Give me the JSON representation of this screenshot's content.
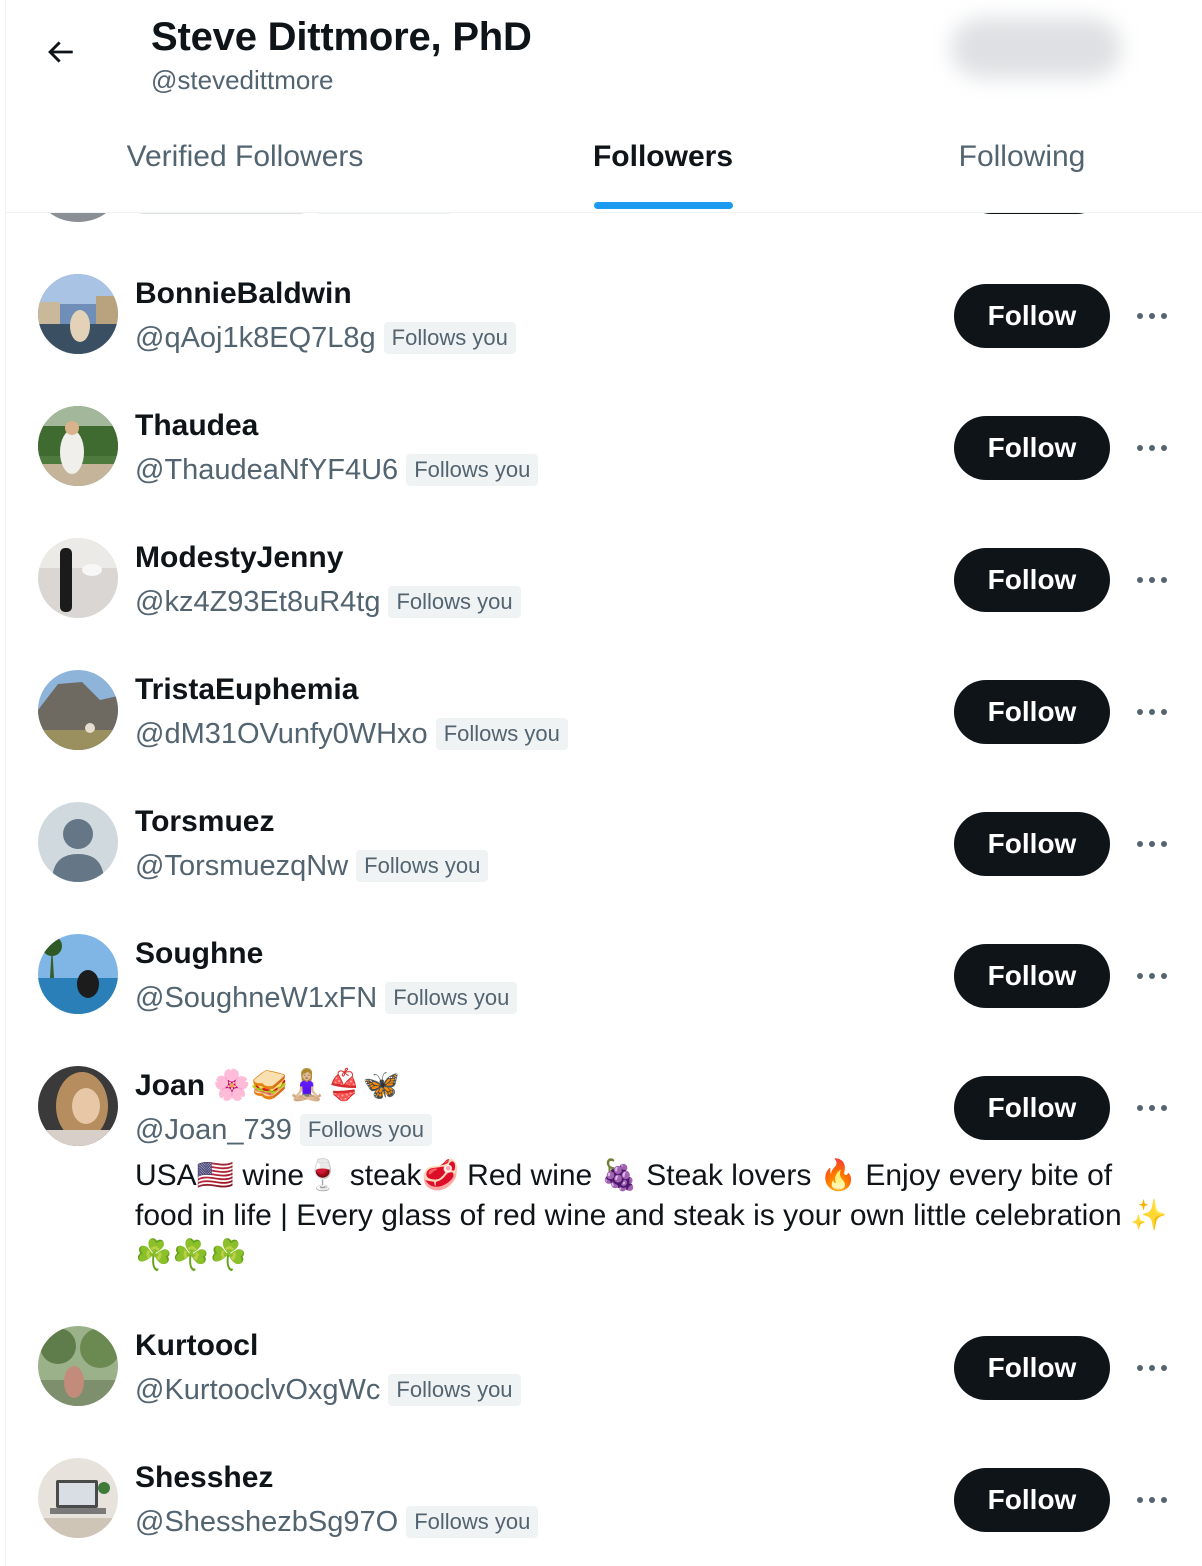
{
  "header": {
    "name": "Steve Dittmore, PhD",
    "handle": "@stevedittmore"
  },
  "tabs": [
    {
      "label": "Verified Followers",
      "active": false
    },
    {
      "label": "Followers",
      "active": true
    },
    {
      "label": "Following",
      "active": false
    }
  ],
  "accent_color": "#1d9bf0",
  "follow_label": "Follow",
  "follows_you_label": "Follows you",
  "users": [
    {
      "name": "BonnieBaldwin",
      "handle": "@qAoj1k8EQ7L8g"
    },
    {
      "name": "Thaudea",
      "handle": "@ThaudeaNfYF4U6"
    },
    {
      "name": "ModestyJenny",
      "handle": "@kz4Z93Et8uR4tg"
    },
    {
      "name": "TristaEuphemia",
      "handle": "@dM31OVunfy0WHxo"
    },
    {
      "name": "Torsmuez",
      "handle": "@TorsmuezqNw"
    },
    {
      "name": "Soughne",
      "handle": "@SoughneW1xFN"
    },
    {
      "name": "Joan 🌸🥪🧘🏼‍♀️👙🦋",
      "handle": "@Joan_739",
      "bio": "USA🇺🇸 wine🍷 steak🥩 Red wine 🍇 Steak lovers 🔥 Enjoy every bite of food in life | Every glass of red wine and steak is your own little celebration ✨ ☘️☘️☘️"
    },
    {
      "name": "Kurtoocl",
      "handle": "@KurtooclvOxgWc"
    },
    {
      "name": "Shesshez",
      "handle": "@ShesshezbSg97O"
    }
  ]
}
